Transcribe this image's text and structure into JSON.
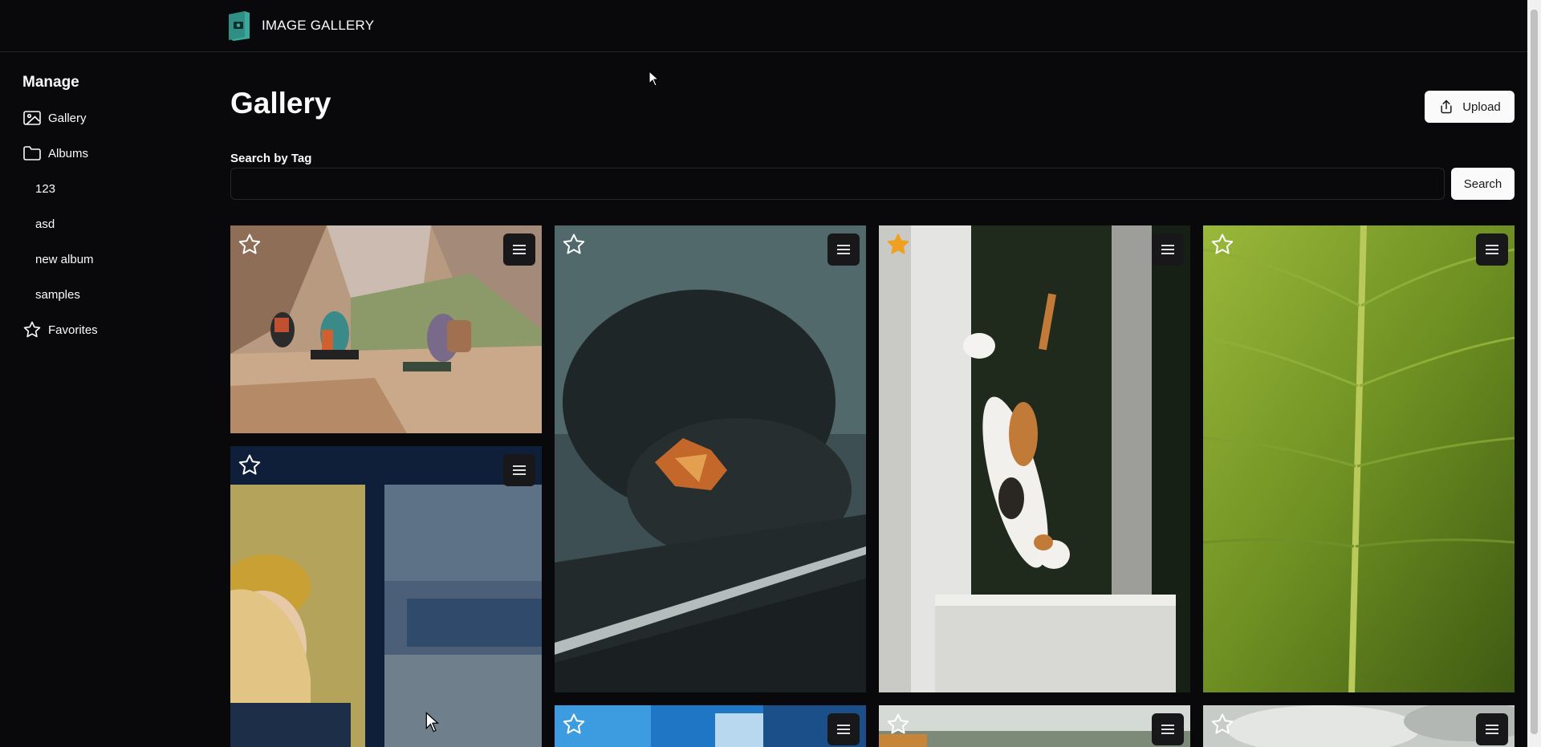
{
  "header": {
    "app_title": "IMAGE GALLERY"
  },
  "sidebar": {
    "heading": "Manage",
    "items": [
      {
        "label": "Gallery",
        "icon": "image-icon"
      },
      {
        "label": "Albums",
        "icon": "folder-icon"
      },
      {
        "label": "123"
      },
      {
        "label": "asd"
      },
      {
        "label": "new album"
      },
      {
        "label": "samples"
      },
      {
        "label": "Favorites",
        "icon": "star-icon"
      }
    ]
  },
  "main": {
    "title": "Gallery",
    "upload_label": "Upload",
    "search": {
      "label": "Search by Tag",
      "value": "",
      "placeholder": "",
      "button_label": "Search"
    }
  },
  "gallery": {
    "images": [
      {
        "subject": "hikers resting in canyon",
        "favorited": false
      },
      {
        "subject": "autumn leaf on wet car window",
        "favorited": false
      },
      {
        "subject": "calico cat on wall",
        "favorited": true
      },
      {
        "subject": "green leaf closeup",
        "favorited": false
      },
      {
        "subject": "laughing person",
        "favorited": false
      },
      {
        "subject": "ocean waves",
        "favorited": false
      },
      {
        "subject": "coastal landscape",
        "favorited": false
      },
      {
        "subject": "cloudy sky",
        "favorited": false
      }
    ]
  },
  "colors": {
    "background": "#09090b",
    "favorite_star": "#f0a020",
    "border": "#27272a"
  }
}
